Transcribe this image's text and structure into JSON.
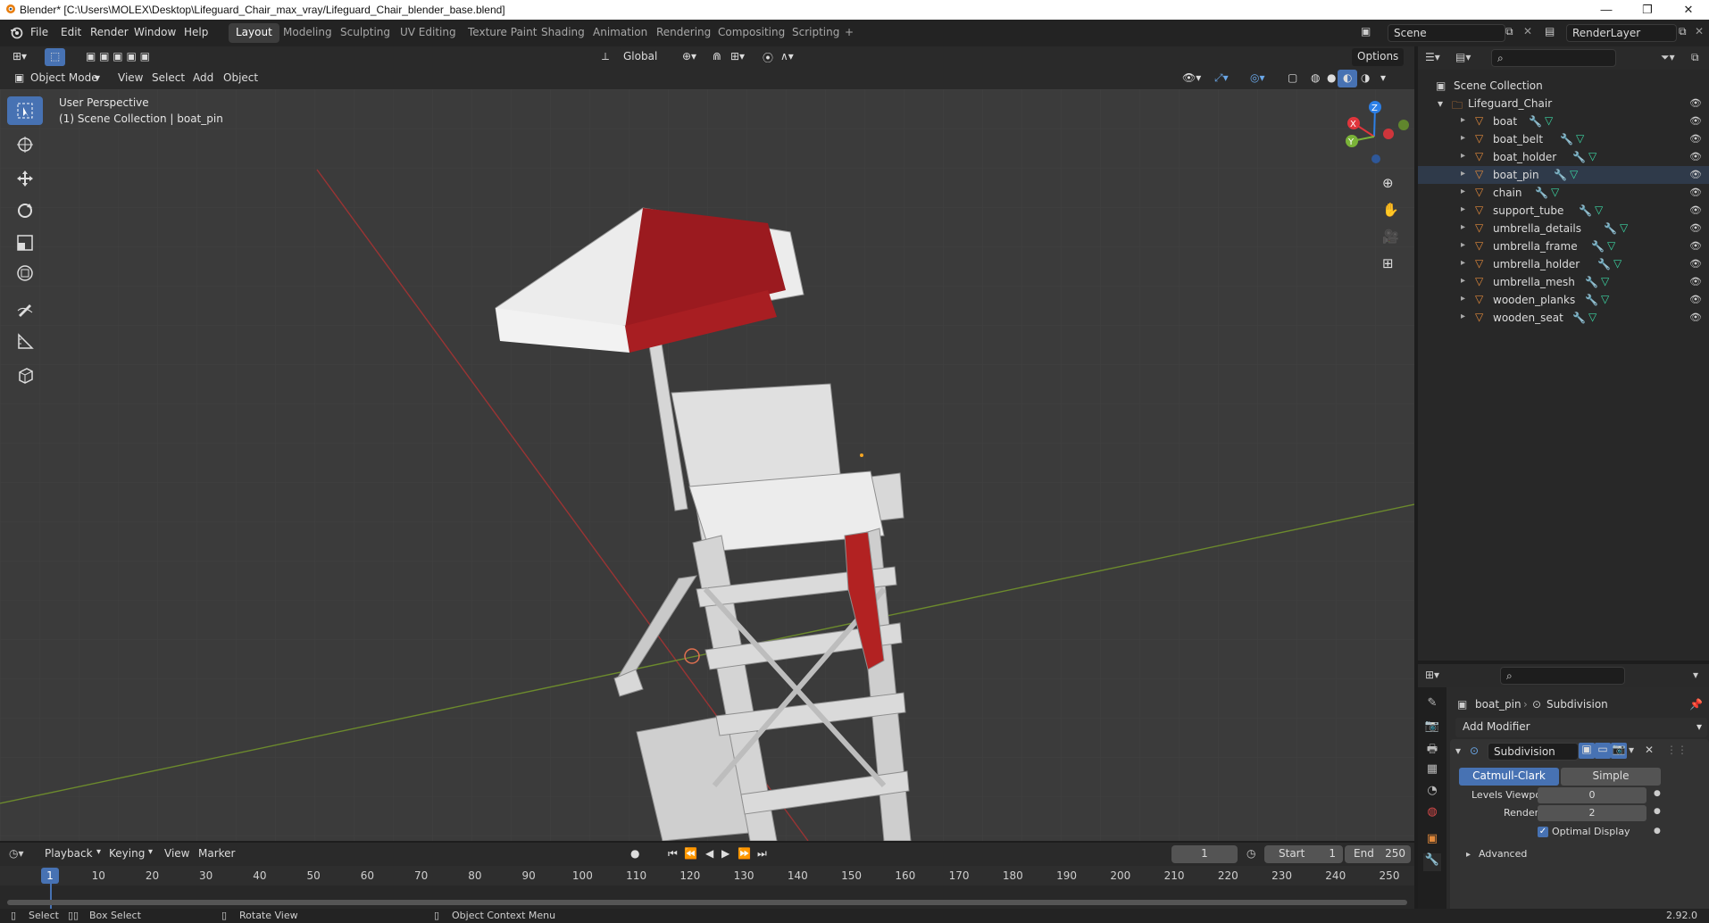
{
  "window": {
    "title": "Blender* [C:\\Users\\MOLEX\\Desktop\\Lifeguard_Chair_max_vray/Lifeguard_Chair_blender_base.blend]",
    "minimize": "—",
    "maximize": "❐",
    "close": "✕"
  },
  "menubar": {
    "items": [
      "File",
      "Edit",
      "Render",
      "Window",
      "Help"
    ],
    "workspaces": [
      "Layout",
      "Modeling",
      "Sculpting",
      "UV Editing",
      "Texture Paint",
      "Shading",
      "Animation",
      "Rendering",
      "Compositing",
      "Scripting"
    ],
    "active_workspace": "Layout",
    "add_workspace": "+",
    "scene": "Scene",
    "render_layer": "RenderLayer"
  },
  "viewport_header": {
    "mode": "Object Mode",
    "menus": [
      "View",
      "Select",
      "Add",
      "Object"
    ],
    "transform_orientation": "Global",
    "options": "Options"
  },
  "viewport": {
    "perspective": "User Perspective",
    "collection_info": "(1) Scene Collection | boat_pin",
    "gizmo_axes": [
      "Z",
      "X",
      "Y"
    ]
  },
  "outliner": {
    "root": "Scene Collection",
    "collection": "Lifeguard_Chair",
    "objects": [
      "boat",
      "boat_belt",
      "boat_holder",
      "boat_pin",
      "chain",
      "support_tube",
      "umbrella_details",
      "umbrella_frame",
      "umbrella_holder",
      "umbrella_mesh",
      "wooden_planks",
      "wooden_seat"
    ],
    "selected_object": "boat_pin"
  },
  "properties": {
    "object_name": "boat_pin",
    "modifier_context": "Subdivision",
    "add_modifier": "Add Modifier",
    "modifier_name": "Subdivision",
    "mode_catmull": "Catmull-Clark",
    "mode_simple": "Simple",
    "levels_viewport_label": "Levels Viewport",
    "levels_viewport_value": "0",
    "render_label": "Render",
    "render_value": "2",
    "optimal_display": "Optimal Display",
    "advanced": "Advanced"
  },
  "timeline": {
    "menus": [
      "Playback",
      "Keying",
      "View",
      "Marker"
    ],
    "current_frame": "1",
    "start_label": "Start",
    "start_value": "1",
    "end_label": "End",
    "end_value": "250",
    "ticks": [
      "1",
      "10",
      "20",
      "30",
      "40",
      "50",
      "60",
      "70",
      "80",
      "90",
      "100",
      "110",
      "120",
      "130",
      "140",
      "150",
      "160",
      "170",
      "180",
      "190",
      "200",
      "210",
      "220",
      "230",
      "240",
      "250"
    ]
  },
  "statusbar": {
    "select": "Select",
    "box_select": "Box Select",
    "rotate_view": "Rotate View",
    "context_menu": "Object Context Menu",
    "version": "2.92.0"
  },
  "colors": {
    "accent": "#4772b3",
    "object_icon": "#e2893b",
    "modifier_icon": "#6aa7e8",
    "mesh_icon": "#3cd6a4",
    "x_axis": "#e0353c",
    "y_axis": "#7ab338",
    "z_axis": "#2c7fe6"
  }
}
